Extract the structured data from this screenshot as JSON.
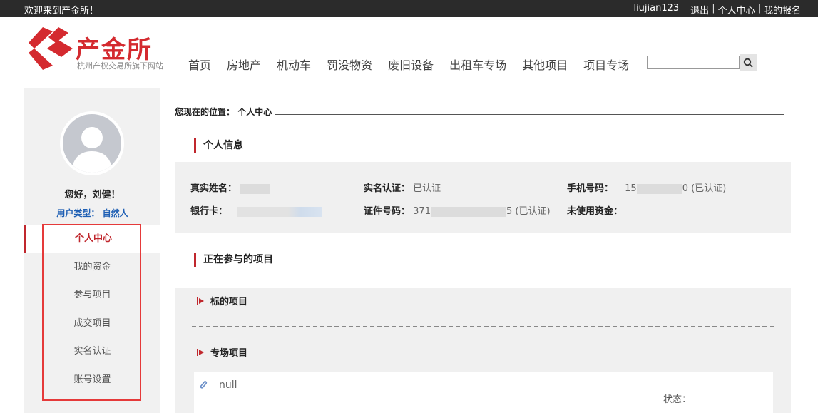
{
  "topbar": {
    "welcome": "欢迎来到产金所！",
    "username": "liujian123",
    "logout": "退出",
    "personal_center": "个人中心",
    "my_signup": "我的报名",
    "separator": "|"
  },
  "logo": {
    "title": "产金所",
    "subtitle": "杭州产权交易所旗下网站",
    "color": "#d42a2f"
  },
  "nav": {
    "items": [
      "首页",
      "房地产",
      "机动车",
      "罚没物资",
      "废旧设备",
      "出租车专场",
      "其他项目",
      "项目专场"
    ]
  },
  "search": {
    "value": "",
    "placeholder": "",
    "icon": "search-icon"
  },
  "sidebar": {
    "greeting": "您好，刘健！",
    "user_type_label": "用户类型：",
    "user_type_value": "自然人",
    "menu": [
      "个人中心",
      "我的资金",
      "参与项目",
      "成交项目",
      "实名认证",
      "账号设置"
    ],
    "active_index": 0,
    "accent": "#c0272d"
  },
  "breadcrumb": {
    "label": "您现在的位置：",
    "current": "个人中心"
  },
  "personal_info": {
    "title": "个人信息",
    "real_name_label": "真实姓名：",
    "real_name_value": "",
    "bank_card_label": "银行卡：",
    "bank_card_value": "",
    "verify_label": "实名认证：",
    "verify_value": "已认证",
    "id_label": "证件号码：",
    "id_prefix": "371",
    "id_suffix": "5",
    "id_status": "(已认证)",
    "phone_label": "手机号码：",
    "phone_prefix": "15",
    "phone_suffix": "0",
    "phone_status": "(已认证)",
    "unused_funds_label": "未使用资金：",
    "unused_funds_value": ""
  },
  "projects": {
    "title": "正在参与的项目",
    "target_label": "标的项目",
    "special_label": "专场项目",
    "card_name": "null",
    "status_label": "状态："
  }
}
